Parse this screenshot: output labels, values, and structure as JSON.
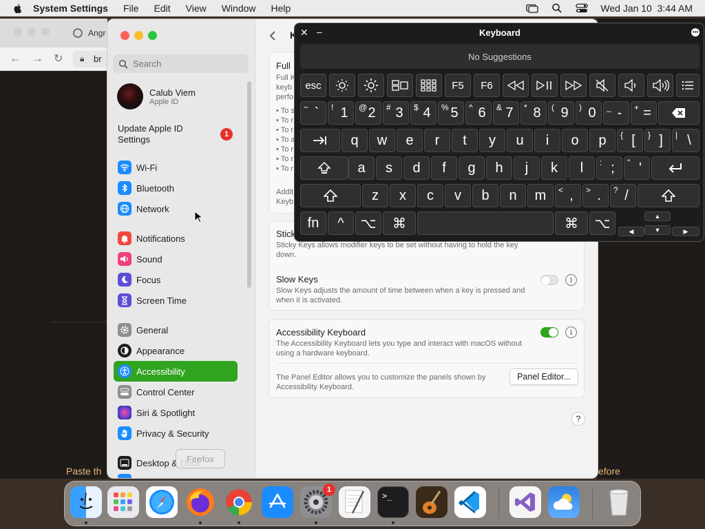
{
  "menubar": {
    "app_name": "System Settings",
    "menus": [
      "File",
      "Edit",
      "View",
      "Window",
      "Help"
    ],
    "datetime": "Wed Jan 10  3:44 AM"
  },
  "browser": {
    "tab_label": "Angr",
    "url_fragment": "br",
    "bg_text_left": "Paste th",
    "bg_text_right": "efore"
  },
  "sidebar": {
    "search_placeholder": "Search",
    "profile": {
      "name": "Calub Viem",
      "subtitle": "Apple ID"
    },
    "update": {
      "label": "Update Apple ID Settings",
      "badge": "1"
    },
    "items": [
      {
        "label": "Wi-Fi",
        "icon": "wifi-icon",
        "color": "#1a8cff"
      },
      {
        "label": "Bluetooth",
        "icon": "bluetooth-icon",
        "color": "#1a8cff"
      },
      {
        "label": "Network",
        "icon": "globe-icon",
        "color": "#1a8cff"
      },
      {
        "label": "Notifications",
        "icon": "bell-icon",
        "color": "#f2473f"
      },
      {
        "label": "Sound",
        "icon": "speaker-icon",
        "color": "#f0407a"
      },
      {
        "label": "Focus",
        "icon": "moon-icon",
        "color": "#5b4fd6"
      },
      {
        "label": "Screen Time",
        "icon": "hourglass-icon",
        "color": "#5b4fd6"
      },
      {
        "label": "General",
        "icon": "gear-icon",
        "color": "#8e8e93"
      },
      {
        "label": "Appearance",
        "icon": "appearance-icon",
        "color": "#1d1d1f"
      },
      {
        "label": "Accessibility",
        "icon": "accessibility-icon",
        "color": "#1a8cff",
        "selected": true
      },
      {
        "label": "Control Center",
        "icon": "control-center-icon",
        "color": "#8e8e93"
      },
      {
        "label": "Siri & Spotlight",
        "icon": "siri-icon",
        "color": "#b34be0"
      },
      {
        "label": "Privacy & Security",
        "icon": "hand-icon",
        "color": "#1a8cff"
      },
      {
        "label": "Desktop & Dock",
        "icon": "dock-icon",
        "color": "#1d1d1f"
      }
    ]
  },
  "content": {
    "header_letter": "K",
    "full_title": "Full",
    "full_desc": [
      "Full K",
      "keyb",
      "perfo"
    ],
    "full_bullets": [
      "• To s",
      "• To r",
      "• To r",
      "• To a",
      "• To r",
      "• To r",
      "• To r"
    ],
    "full_footer": [
      "Addit",
      "Keyb"
    ],
    "sticky": {
      "title": "Stick",
      "desc": "Sticky Keys allows modifier keys to be set without having to hold the key down."
    },
    "slow": {
      "title": "Slow Keys",
      "desc": "Slow Keys adjusts the amount of time between when a key is pressed and when it is activated.",
      "on": false
    },
    "acc_kb": {
      "title": "Accessibility Keyboard",
      "desc": "The Accessibility Keyboard lets you type and interact with macOS without using a hardware keyboard.",
      "on": true
    },
    "panel_editor": {
      "desc": "The Panel Editor allows you to customize the panels shown by Accessibility Keyboard.",
      "button": "Panel Editor..."
    },
    "help": "?"
  },
  "keyboard": {
    "title": "Keyboard",
    "suggestions": "No Suggestions",
    "fn_row": [
      "esc",
      "brightness-down-icon",
      "brightness-up-icon",
      "mission-control-icon",
      "launchpad-icon",
      "F5",
      "F6",
      "rewind-icon",
      "play-pause-icon",
      "fast-forward-icon",
      "mute-icon",
      "volume-down-icon",
      "volume-up-icon",
      "menu-icon"
    ],
    "row1": [
      [
        "~",
        "`"
      ],
      [
        "!",
        "1"
      ],
      [
        "@",
        "2"
      ],
      [
        "#",
        "3"
      ],
      [
        "$",
        "4"
      ],
      [
        "%",
        "5"
      ],
      [
        "^",
        "6"
      ],
      [
        "&",
        "7"
      ],
      [
        "*",
        "8"
      ],
      [
        "(",
        "9"
      ],
      [
        ")",
        "0"
      ],
      [
        "_",
        "-"
      ],
      [
        "+",
        "="
      ]
    ],
    "row2": [
      "q",
      "w",
      "e",
      "r",
      "t",
      "y",
      "u",
      "i",
      "o",
      "p"
    ],
    "row2_extra": [
      [
        "{",
        "["
      ],
      [
        "}",
        "]"
      ],
      [
        "|",
        "\\"
      ]
    ],
    "row3": [
      "a",
      "s",
      "d",
      "f",
      "g",
      "h",
      "j",
      "k",
      "l"
    ],
    "row3_extra": [
      [
        ":",
        ";"
      ],
      [
        "\"",
        "'"
      ]
    ],
    "row4": [
      "z",
      "x",
      "c",
      "v",
      "b",
      "n",
      "m"
    ],
    "row4_extra": [
      [
        "<",
        ","
      ],
      [
        ">",
        "."
      ],
      [
        "?",
        "/"
      ]
    ],
    "row5": {
      "fn": "fn",
      "ctrl": "^",
      "option": "⌥",
      "command": "⌘"
    }
  },
  "dock": {
    "tooltip": "Firefox",
    "settings_badge": "1",
    "apps": [
      "Finder",
      "Launchpad",
      "Safari",
      "Firefox",
      "Chrome",
      "App Store",
      "System Settings",
      "TextEdit",
      "Terminal",
      "GarageBand",
      "Visual Studio Code",
      "Visual Studio",
      "Weather",
      "Trash"
    ]
  }
}
